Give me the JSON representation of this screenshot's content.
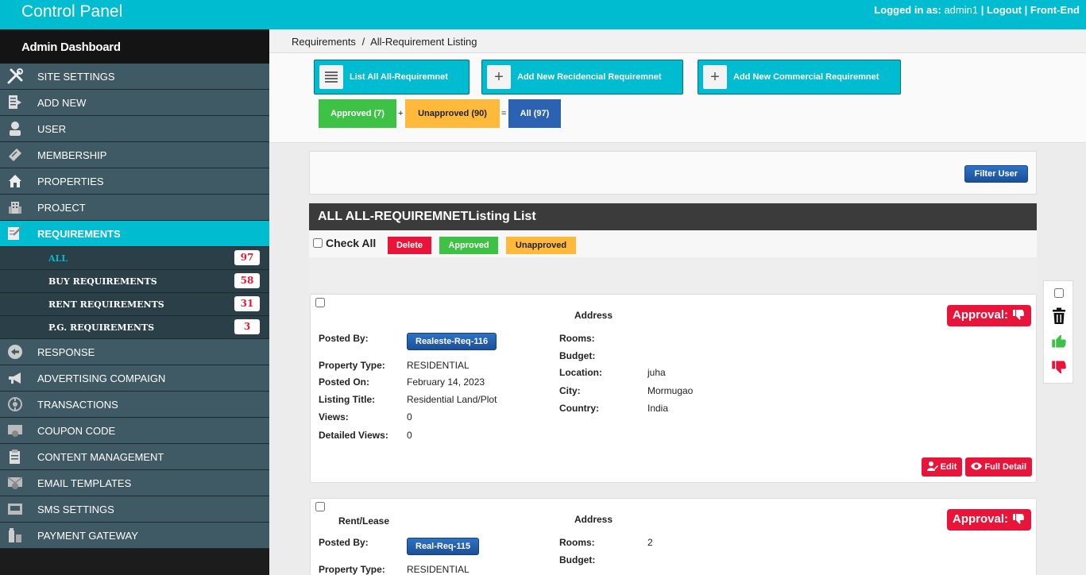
{
  "topbar": {
    "brand": "Control Panel",
    "logged_prefix": "Logged in as:",
    "user": "admin1",
    "sep1": "|",
    "logout": "Logout",
    "sep2": "|",
    "frontend": "Front-End"
  },
  "sidebar": {
    "title": "Admin Dashboard",
    "items": [
      {
        "label": "SITE SETTINGS",
        "icon": "tools-icon"
      },
      {
        "label": "ADD NEW",
        "icon": "add-document-icon"
      },
      {
        "label": "USER",
        "icon": "user-icon"
      },
      {
        "label": "MEMBERSHIP",
        "icon": "ticket-icon"
      },
      {
        "label": "PROPERTIES",
        "icon": "house-icon"
      },
      {
        "label": "PROJECT",
        "icon": "building-icon"
      },
      {
        "label": "REQUIREMENTS",
        "icon": "notepad-icon"
      },
      {
        "label": "RESPONSE",
        "icon": "back-arrow-icon"
      },
      {
        "label": "ADVERTISING COMPAIGN",
        "icon": "megaphone-icon"
      },
      {
        "label": "TRANSACTIONS",
        "icon": "transactions-icon"
      },
      {
        "label": "COUPON CODE",
        "icon": "coupon-icon"
      },
      {
        "label": "CONTENT MANAGEMENT",
        "icon": "clipboard-icon"
      },
      {
        "label": "EMAIL TEMPLATES",
        "icon": "email-icon"
      },
      {
        "label": "SMS SETTINGS",
        "icon": "sms-icon"
      },
      {
        "label": "PAYMENT GATEWAY",
        "icon": "payment-icon"
      }
    ],
    "sub_items": [
      {
        "label": "ALL",
        "count": "97"
      },
      {
        "label": "BUY REQUIREMENTS",
        "count": "58"
      },
      {
        "label": "RENT REQUIREMENTS",
        "count": "31"
      },
      {
        "label": "P.G. REQUIREMENTS",
        "count": "3"
      }
    ]
  },
  "breadcrumb": {
    "parent": "Requirements",
    "sep": "/",
    "current": "All-Requirement Listing"
  },
  "actions": {
    "list_all": "List All All-Requiremnet",
    "add_residential": "Add New Recidencial Requiremnet",
    "add_commercial": "Add New Commercial Requiremnet"
  },
  "stats": {
    "approved": "Approved (7)",
    "plus": "+",
    "unapproved": "Unapproved (90)",
    "equals": "=",
    "all": "All (97)"
  },
  "filter": {
    "button": "Filter User"
  },
  "listing": {
    "title": "ALL ALL-REQUIREMNETListing List",
    "check_all": "Check All",
    "delete": "Delete",
    "approved": "Approved",
    "unapproved": "Unapproved"
  },
  "cards": [
    {
      "heading_left": "",
      "heading_address": "Address",
      "approval": "Approval:",
      "posted_by_label": "Posted By:",
      "posted_by": "Realeste-Req-116",
      "property_type_label": "Property Type:",
      "property_type": "RESIDENTIAL",
      "posted_on_label": "Posted On:",
      "posted_on": "February 14, 2023",
      "listing_title_label": "Listing Title:",
      "listing_title": "Residential Land/Plot",
      "views_label": "Views:",
      "views": "0",
      "detailed_views_label": "Detailed Views:",
      "detailed_views": "0",
      "rooms_label": "Rooms:",
      "rooms": "",
      "budget_label": "Budget:",
      "budget": "",
      "location_label": "Location:",
      "location": "juha",
      "city_label": "City:",
      "city": "Mormugao",
      "country_label": "Country:",
      "country": "India",
      "edit": "Edit",
      "full_detail": "Full Detail"
    },
    {
      "heading_left": "Rent/Lease",
      "heading_address": "Address",
      "approval": "Approval:",
      "posted_by_label": "Posted By:",
      "posted_by": "Real-Req-115",
      "property_type_label": "Property Type:",
      "property_type": "RESIDENTIAL",
      "rooms_label": "Rooms:",
      "rooms": "2",
      "budget_label": "Budget:",
      "budget": ""
    }
  ],
  "colors": {
    "accent": "#00bcd1",
    "sidebar_item": "#3f5965",
    "sidebar_sub": "#2b3f48",
    "danger": "#e8143a",
    "success": "#3ec246",
    "warning": "#ffba3b",
    "primary": "#2c62b2"
  }
}
